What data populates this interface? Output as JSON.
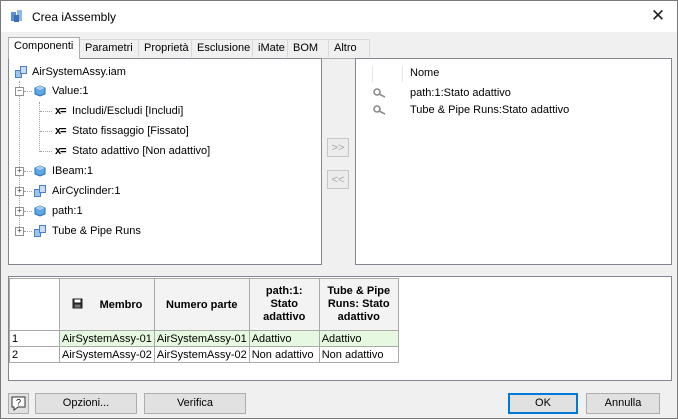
{
  "window": {
    "title": "Crea iAssembly",
    "close": "✕"
  },
  "tabs": [
    {
      "label": "Componenti",
      "active": true
    },
    {
      "label": "Parametri"
    },
    {
      "label": "Proprietà"
    },
    {
      "label": "Esclusione"
    },
    {
      "label": "iMate"
    },
    {
      "label": "BOM"
    },
    {
      "label": "Altro"
    }
  ],
  "tree": {
    "root": "AirSystemAssy.iam",
    "value_node": "Value:1",
    "value_children": [
      "Includi/Escludi [Includi]",
      "Stato fissaggio [Fissato]",
      "Stato adattivo [Non adattivo]"
    ],
    "nodes": [
      "IBeam:1",
      "AirCyclinder:1",
      "path:1",
      "Tube & Pipe Runs"
    ],
    "param_symbol": "x=",
    "expand_minus": "−",
    "expand_plus": "+"
  },
  "move_buttons": {
    "add": ">>",
    "remove": "<<"
  },
  "selected_list": {
    "header": "Nome",
    "items": [
      "path:1:Stato adattivo",
      "Tube & Pipe Runs:Stato adattivo"
    ]
  },
  "table": {
    "headers": [
      "Membro",
      "Numero parte",
      "path:1: Stato adattivo",
      "Tube & Pipe Runs: Stato adattivo"
    ],
    "rows": [
      {
        "num": "1",
        "cells": [
          "AirSystemAssy-01",
          "AirSystemAssy-01",
          "Adattivo",
          "Adattivo"
        ]
      },
      {
        "num": "2",
        "cells": [
          "AirSystemAssy-02",
          "AirSystemAssy-02",
          "Non adattivo",
          "Non adattivo"
        ]
      }
    ]
  },
  "buttons": {
    "help": "?",
    "options": "Opzioni...",
    "verify": "Verifica",
    "ok": "OK",
    "cancel": "Annulla"
  }
}
